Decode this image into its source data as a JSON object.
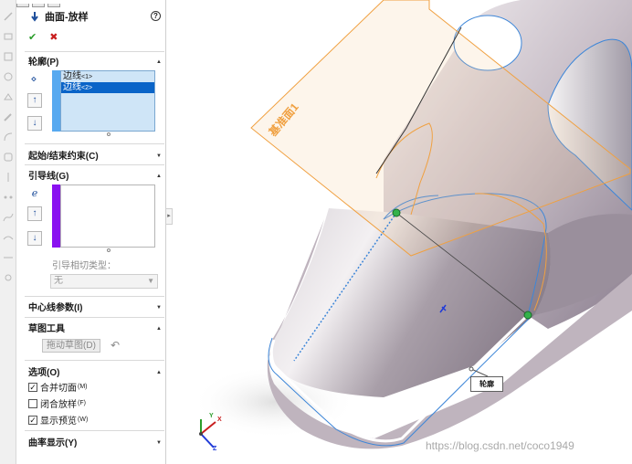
{
  "feature": {
    "title": "曲面-放样",
    "icon": "loft-surface-icon",
    "help_icon": "help-icon",
    "ok_icon": "checkmark-icon",
    "cancel_icon": "close-icon"
  },
  "profiles": {
    "header": "轮廓(P)",
    "items": [
      {
        "label": "边线",
        "suffix": "<1>",
        "selected": false
      },
      {
        "label": "边线",
        "suffix": "<2>",
        "selected": true
      }
    ],
    "accent_color": "#57a9f0"
  },
  "start_end": {
    "header": "起始/结束约束(C)"
  },
  "guides": {
    "header": "引导线(G)",
    "accent_color": "#8a11f0",
    "tangency_label": "引导相切类型：",
    "tangency_value": "无"
  },
  "centerline": {
    "header": "中心线参数(I)"
  },
  "sketch_tools": {
    "header": "草图工具",
    "drag_button": "拖动草图(D)"
  },
  "options": {
    "header": "选项(O)",
    "checks": [
      {
        "label": "合并切面",
        "key": "(M)",
        "checked": true
      },
      {
        "label": "闭合放样",
        "key": "(F)",
        "checked": false
      },
      {
        "label": "显示预览",
        "key": "(W)",
        "checked": true
      }
    ]
  },
  "curvature": {
    "header": "曲率显示(Y)"
  },
  "viewport": {
    "plane_label": "基准面1",
    "callout_label": "轮廓",
    "watermark": "https://blog.csdn.net/coco1949",
    "triad": {
      "x": "X",
      "y": "Y",
      "z": "Z"
    },
    "colors": {
      "plane": "#f0a040",
      "edge_selected": "#ffffff",
      "edge_blue": "#3d86d8",
      "point_green": "#33b24a"
    }
  }
}
